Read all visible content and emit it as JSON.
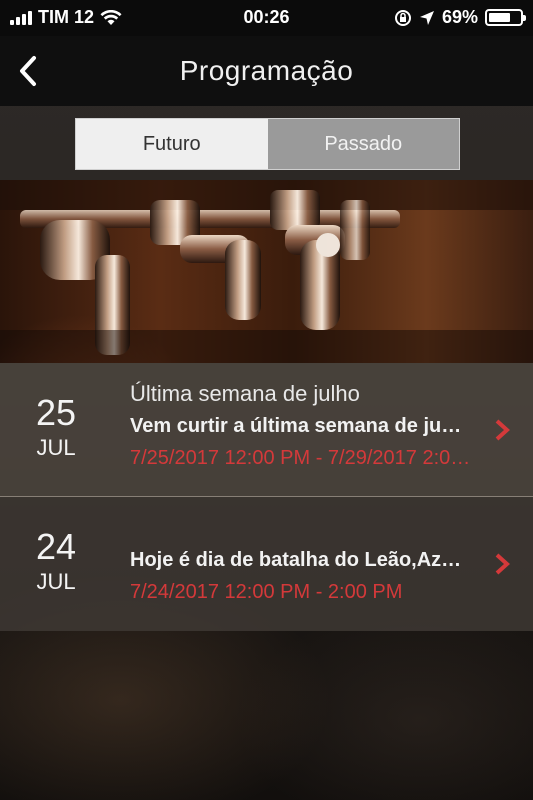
{
  "status": {
    "carrier": "TIM 12",
    "time": "00:26",
    "battery": "69%",
    "battery_level": 0.69,
    "icons": [
      "signal-icon",
      "wifi-icon",
      "rotation-lock-icon",
      "location-icon",
      "battery-icon"
    ]
  },
  "nav": {
    "title": "Programação",
    "back_icon": "chevron-left-icon"
  },
  "tabs": [
    {
      "label": "Futuro",
      "active": true
    },
    {
      "label": "Passado",
      "active": false
    }
  ],
  "events": [
    {
      "day": "25",
      "month": "JUL",
      "title": "Última semana de julho",
      "description": "Vem curtir a última semana de ju…",
      "time": "7/25/2017 12:00 PM - 7/29/2017 2:0…"
    },
    {
      "day": "24",
      "month": "JUL",
      "title": "",
      "description": "Hoje é dia de batalha do Leão,Az…",
      "time": "7/24/2017 12:00 PM - 2:00 PM"
    }
  ],
  "colors": {
    "accent_red": "#d4393a",
    "nav_bg": "#0f0f0f"
  }
}
